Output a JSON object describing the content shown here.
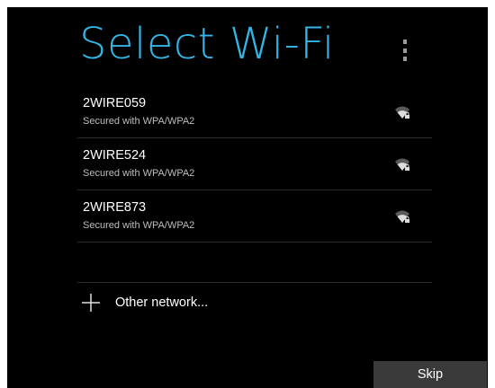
{
  "header": {
    "title": "Select Wi-Fi",
    "menu_icon": "overflow-menu-icon",
    "title_color": "#33b5e5"
  },
  "networks": [
    {
      "ssid": "2WIRE059",
      "security": "Secured with WPA/WPA2",
      "icon": "wifi-signal-locked-icon"
    },
    {
      "ssid": "2WIRE524",
      "security": "Secured with WPA/WPA2",
      "icon": "wifi-signal-locked-icon"
    },
    {
      "ssid": "2WIRE873",
      "security": "Secured with WPA/WPA2",
      "icon": "wifi-signal-locked-icon"
    }
  ],
  "other_network": {
    "label": "Other network...",
    "icon": "plus-icon"
  },
  "footer": {
    "skip_label": "Skip"
  }
}
